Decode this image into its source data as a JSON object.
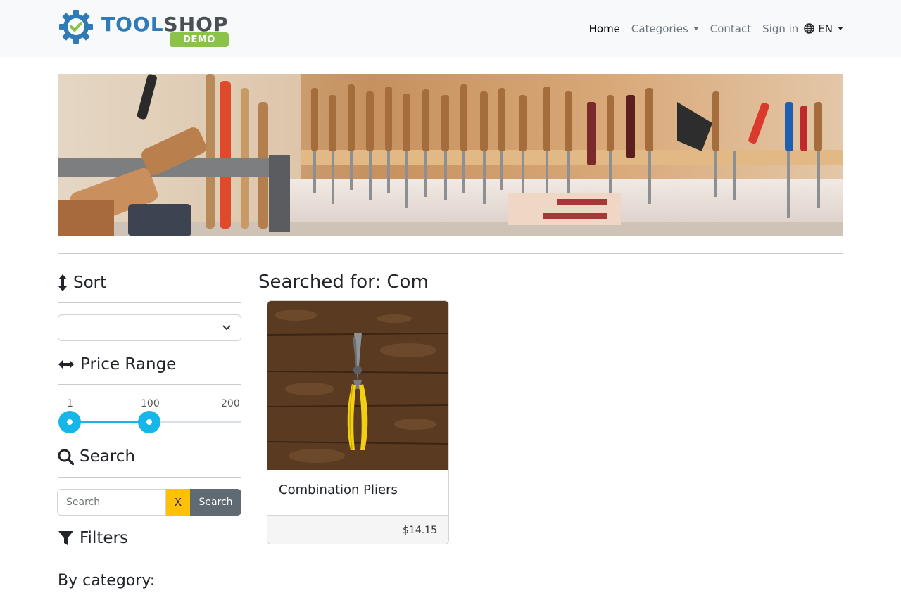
{
  "brand": {
    "word1": "TOOL",
    "word2": "SHOP",
    "badge": "DEMO"
  },
  "nav": {
    "home": "Home",
    "categories": "Categories",
    "contact": "Contact",
    "sign_in": "Sign in",
    "language": "EN"
  },
  "sidebar": {
    "sort_heading": "Sort",
    "sort_selected": "",
    "price_heading": "Price Range",
    "price_min_label": "1",
    "price_current_label": "100",
    "price_max_label": "200",
    "price_range": {
      "min": 1,
      "max": 200,
      "low": 1,
      "high": 100
    },
    "search_heading": "Search",
    "search_placeholder": "Search",
    "search_value": "",
    "clear_label": "X",
    "search_button_label": "Search",
    "filters_heading": "Filters",
    "by_category": "By category:"
  },
  "results": {
    "title": "Searched for: Com",
    "products": [
      {
        "name": "Combination Pliers",
        "price": "$14.15"
      }
    ]
  },
  "colors": {
    "accent": "#17b6e8",
    "clear_button": "#ffc107",
    "search_button": "#5f6a73",
    "brand_blue": "#2f7ab7",
    "brand_green": "#8bc34a"
  }
}
